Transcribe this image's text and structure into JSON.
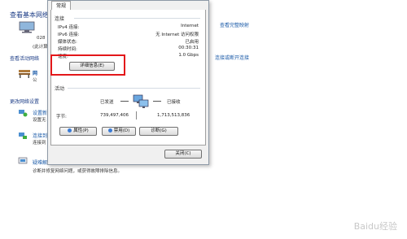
{
  "background": {
    "title": "查看基本网络",
    "right_link_top": "查看完整映射",
    "right_link_mid": "连接或断开连接",
    "number_text": "028",
    "partial_text": "(此计算",
    "section_active": "查看活动网络",
    "network_name": "网",
    "network_sub": "公",
    "section_change": "更改网络设置",
    "link_settings": "设置新",
    "link_settings_sub": "设置无",
    "link_connect": "连接到",
    "link_connect_sub": "连接到",
    "link_troubleshoot": "疑难解",
    "troubleshoot_desc": "诊断并修复网络问题，或获得故障排除信息。"
  },
  "dialog": {
    "tab_general": "常规",
    "section_connection": "连接",
    "rows": [
      {
        "label": "IPv4 连接:",
        "value": "Internet"
      },
      {
        "label": "IPv6 连接:",
        "value": "无 Internet 访问权限"
      },
      {
        "label": "媒体状态:",
        "value": "已启用"
      },
      {
        "label": "持续时间:",
        "value": "00:30:31"
      },
      {
        "label": "速度:",
        "value": "1.0 Gbps"
      }
    ],
    "details_button": "详细信息(E)",
    "section_activity": "活动",
    "sent_label": "已发送",
    "received_label": "已接收",
    "bytes_label": "字节:",
    "bytes_sent": "739,497,406",
    "bytes_received": "1,713,513,836",
    "properties_button": "属性(P)",
    "disable_button": "禁用(D)",
    "diagnose_button": "诊断(G)",
    "close_button": "关闭(C)"
  },
  "watermark": "Baidu经验",
  "colors": {
    "highlight": "#e3171a",
    "link": "#1a5aa8",
    "title": "#1e3e87"
  }
}
